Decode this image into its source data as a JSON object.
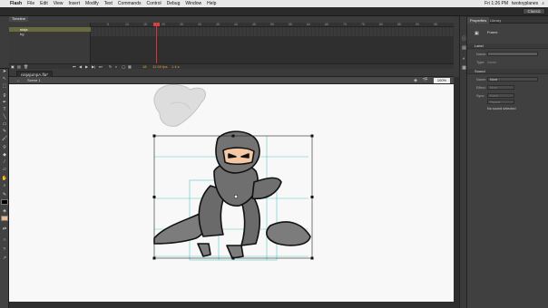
{
  "menubar": {
    "app": "Flash",
    "items": [
      "File",
      "Edit",
      "View",
      "Insert",
      "Modify",
      "Text",
      "Commands",
      "Control",
      "Debug",
      "Window",
      "Help"
    ],
    "clock": "Fri 1:26 PM",
    "user": "twotoyplanes"
  },
  "workspace": {
    "label": "Classic"
  },
  "timeline": {
    "tab": "Timeline",
    "layers": [
      {
        "name": "ninja",
        "selected": true
      },
      {
        "name": "bg",
        "selected": false
      }
    ],
    "ruler_ticks": [
      "5",
      "10",
      "15",
      "20",
      "25",
      "30",
      "35",
      "40",
      "45",
      "50",
      "55",
      "60",
      "65",
      "70",
      "75",
      "80",
      "85",
      "90",
      "95"
    ],
    "current_frame": "18",
    "fps": "12.00 fps",
    "time": "1.4 s"
  },
  "document": {
    "tab": "ninjajumpA.fla*"
  },
  "stage": {
    "scene": "Scene 1",
    "zoom": "100%"
  },
  "properties": {
    "tabs": [
      "Properties",
      "Library"
    ],
    "object_type": "Frame",
    "sections": {
      "label": {
        "title": "Label",
        "name_label": "Name:",
        "type_label": "Type:",
        "type_value": "Name"
      },
      "sound": {
        "title": "Sound",
        "name_label": "Name:",
        "name_value": "None",
        "effect_label": "Effect:",
        "effect_value": "None",
        "sync_label": "Sync:",
        "sync_value": "Event",
        "repeat_value": "Repeat",
        "status": "No sound selected"
      }
    }
  },
  "colors": {
    "stage": "#f8f8f8",
    "ui_dark": "#3a3a3a",
    "playhead": "#dd3333",
    "selection": "#000000",
    "guides": "#5fc6c6"
  }
}
